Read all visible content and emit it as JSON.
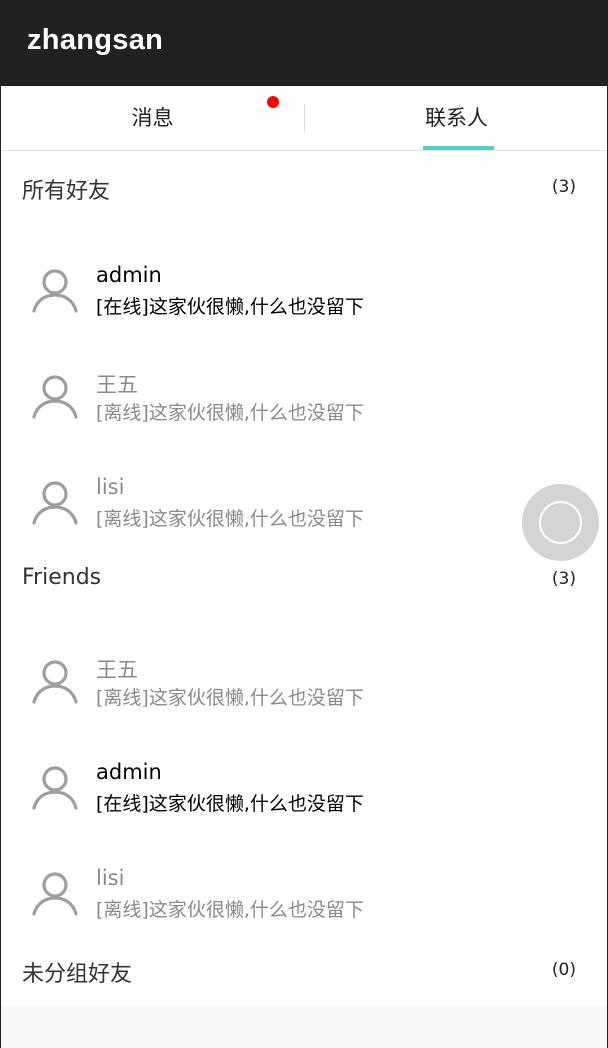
{
  "appbar": {
    "title": "zhangsan"
  },
  "tabs": [
    {
      "label": "消息",
      "has_badge": true,
      "selected": false
    },
    {
      "label": "联系人",
      "selected": true
    }
  ],
  "colors": {
    "accent": "#4fd1c5",
    "badge": "#ff0000",
    "appbar": "#212121"
  },
  "groups": [
    {
      "name": "所有好友",
      "count": "(3)",
      "contacts": [
        {
          "name": "admin",
          "signature": "[在线]这家伙很懒,什么也没留下",
          "status": "online"
        },
        {
          "name": "王五",
          "signature": "[离线]这家伙很懒,什么也没留下",
          "status": "offline"
        },
        {
          "name": "lisi",
          "signature": "[离线]这家伙很懒,什么也没留下",
          "status": "offline"
        }
      ]
    },
    {
      "name": "Friends",
      "count": "(3)",
      "contacts": [
        {
          "name": "王五",
          "signature": "[离线]这家伙很懒,什么也没留下",
          "status": "offline"
        },
        {
          "name": "admin",
          "signature": "[在线]这家伙很懒,什么也没留下",
          "status": "online"
        },
        {
          "name": "lisi",
          "signature": "[离线]这家伙很懒,什么也没留下",
          "status": "offline"
        }
      ]
    },
    {
      "name": "未分组好友",
      "count": "(0)",
      "contacts": []
    }
  ],
  "avatar_icon": "user-outline-icon",
  "floating_button_icon": "circle-icon"
}
